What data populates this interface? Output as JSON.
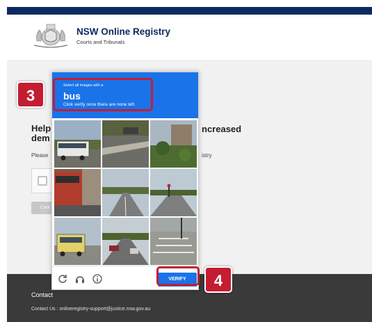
{
  "header": {
    "title": "NSW Online Registry",
    "subtitle": "Courts and Tribunals"
  },
  "page": {
    "heading_left": "Help",
    "heading_left_line2": "dem",
    "heading_right": "ncreased",
    "intro_left": "Please",
    "intro_right": "istry",
    "continue_label": "Cont"
  },
  "footer": {
    "contact_heading": "Contact",
    "contact_line": "Contact Us : onlineregistry-support@justice.nsw.gov.au"
  },
  "captcha": {
    "instruction_line1": "Select all images with a",
    "target_object": "bus",
    "instruction_line3": "Click verify once there are none left.",
    "verify_label": "VERIFY",
    "icons": [
      "reload-icon",
      "headphones-icon",
      "info-icon"
    ]
  },
  "callouts": {
    "step3": "3",
    "step4": "4"
  },
  "colors": {
    "navy": "#0d2a60",
    "captcha_blue": "#1a73e8",
    "callout_red": "#c41d32",
    "footer": "#3a3a3a"
  }
}
